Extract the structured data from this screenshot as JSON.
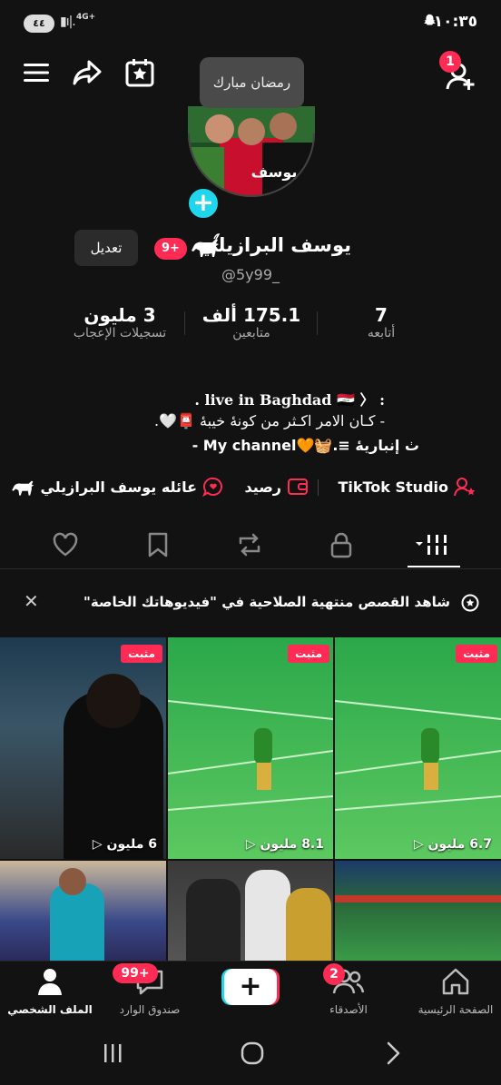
{
  "status": {
    "time": "١٠:٣٥",
    "battery": "٤٤",
    "network": "4G+"
  },
  "header": {
    "add_friend_badge": "1",
    "tooltip": "رمضان مبارك"
  },
  "profile": {
    "name": "يوسف البرازيلي",
    "name_badge": "9+",
    "handle": "@5y99_",
    "edit_label": "تعديل",
    "stats": [
      {
        "value": "7",
        "label": "أتابعه"
      },
      {
        "value": "175.1 ألف",
        "label": "متابعين"
      },
      {
        "value": "3 مليون",
        "label": "تسجيلات الإعجاب"
      }
    ],
    "bio": [
      ". live in Baghdad 🇮🇶 〉 :",
      "- كـان الامر اكـثر من كونهٔ خيبهٔ 📮🤍.",
      "ٺ إنباريهٔ ≡.🧺🧡My channel -"
    ],
    "links": {
      "studio": "TikTok Studio",
      "balance": "رصيد",
      "family": "عائله يوسف البرازيلي"
    }
  },
  "banner": {
    "text": "شاهد القصص منتهية الصلاحية في \"فيديوهاتك الخاصة\""
  },
  "videos": [
    {
      "pinned": "مثبت",
      "views": "6 مليون"
    },
    {
      "pinned": "مثبت",
      "views": "8.1 مليون"
    },
    {
      "pinned": "مثبت",
      "views": "6.7 مليون"
    },
    {
      "pinned": "",
      "views": ""
    },
    {
      "pinned": "",
      "views": ""
    },
    {
      "pinned": "",
      "views": ""
    }
  ],
  "nav": {
    "home": "الصفحة الرئيسية",
    "friends": "الأصدقاء",
    "friends_badge": "2",
    "inbox": "صندوق الوارد",
    "inbox_badge": "99+",
    "profile": "الملف الشخصي"
  },
  "colors": {
    "accent": "#fe2c55",
    "background": "#121212",
    "add_blue": "#20d5ec"
  }
}
